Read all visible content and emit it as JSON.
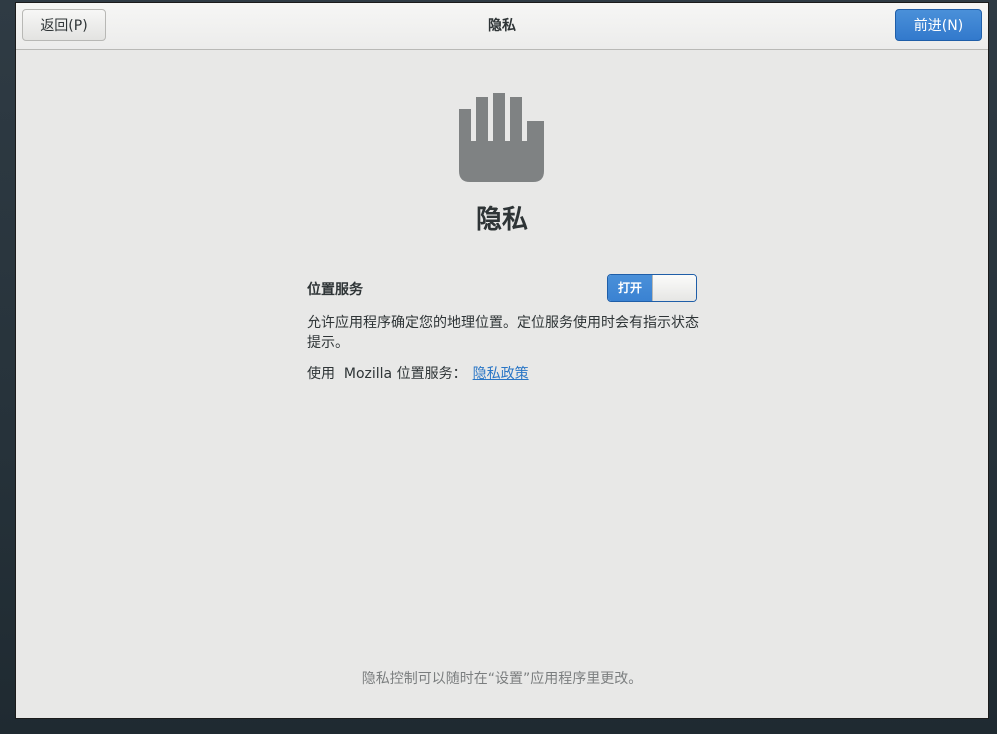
{
  "header": {
    "back_label": "返回(P)",
    "title": "隐私",
    "next_label": "前进(N)"
  },
  "main": {
    "icon": "hand-stop-icon",
    "title": "隐私",
    "location": {
      "label": "位置服务",
      "switch_state": "打开",
      "description": "允许应用程序确定您的地理位置。定位服务使用时会有指示状态提示。",
      "mozilla_prefix": "使用  Mozilla 位置服务：",
      "policy_link": "隐私政策"
    }
  },
  "footer": {
    "note": "隐私控制可以随时在“设置”应用程序里更改。"
  },
  "colors": {
    "accent": "#4a90d9",
    "window_bg": "#e8e8e7",
    "text": "#2e3436",
    "muted": "#7b7e7f",
    "icon": "#7f8283"
  }
}
